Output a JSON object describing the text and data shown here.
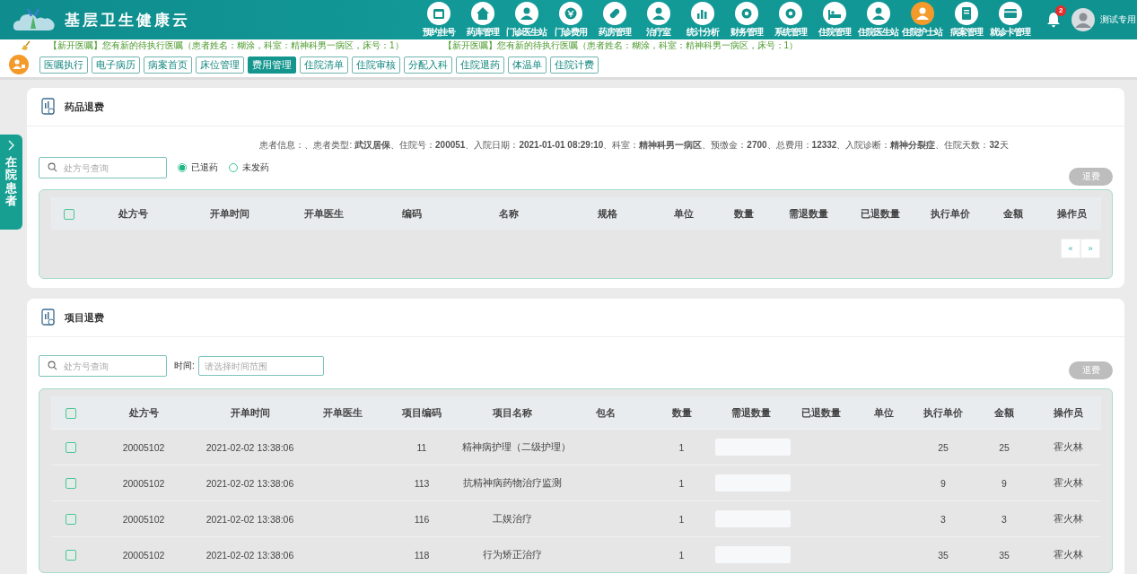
{
  "app": {
    "title": "基层卫生健康云"
  },
  "nav": [
    {
      "label": "预约挂号",
      "selected": false
    },
    {
      "label": "药库管理",
      "selected": false
    },
    {
      "label": "门诊医生站",
      "selected": false
    },
    {
      "label": "门诊费用",
      "selected": false
    },
    {
      "label": "药房管理",
      "selected": false
    },
    {
      "label": "治疗室",
      "selected": false
    },
    {
      "label": "统计分析",
      "selected": false
    },
    {
      "label": "财务管理",
      "selected": false
    },
    {
      "label": "系统管理",
      "selected": false
    },
    {
      "label": "住院管理",
      "selected": false
    },
    {
      "label": "住院医生站",
      "selected": false
    },
    {
      "label": "住院护士站",
      "selected": true
    },
    {
      "label": "病案管理",
      "selected": false
    },
    {
      "label": "就诊卡管理",
      "selected": false
    }
  ],
  "notifications": {
    "badge": "2"
  },
  "user": {
    "name": "测试专用"
  },
  "notices": [
    "【新开医嘱】您有新的待执行医嘱（患者姓名：糊涂，科室：精神科男一病区，床号：1）",
    "【新开医嘱】您有新的待执行医嘱（患者姓名：糊涂，科室：精神科男一病区，床号：1）"
  ],
  "tabs": [
    {
      "label": "医嘱执行",
      "selected": false
    },
    {
      "label": "电子病历",
      "selected": false
    },
    {
      "label": "病案首页",
      "selected": false
    },
    {
      "label": "床位管理",
      "selected": false
    },
    {
      "label": "费用管理",
      "selected": true
    },
    {
      "label": "住院清单",
      "selected": false
    },
    {
      "label": "住院审核",
      "selected": false
    },
    {
      "label": "分配入科",
      "selected": false
    },
    {
      "label": "住院退药",
      "selected": false
    },
    {
      "label": "体温单",
      "selected": false
    },
    {
      "label": "住院计费",
      "selected": false
    }
  ],
  "side_tab": {
    "label": "在院患者"
  },
  "drug_refund": {
    "title": "药品退费",
    "patient_info": "患者信息：、患者类型: **武汉居保**、住院号：**200051**、入院日期：**2021-01-01 08:29:10**、科室：**精神科男一病区**、预缴金：**2700**、总费用：**12332**、入院诊断：**精神分裂症**、住院天数：**32**天",
    "search": {
      "placeholder": "处方号查询"
    },
    "radios": [
      {
        "label": "已退药",
        "selected": true
      },
      {
        "label": "未发药",
        "selected": false
      }
    ],
    "refund_button": {
      "label": "退费",
      "disabled": true
    },
    "table": {
      "header_checkbox": {
        "checked": false
      },
      "columns": [
        "处方号",
        "开单时间",
        "开单医生",
        "编码",
        "名称",
        "规格",
        "单位",
        "数量",
        "需退数量",
        "已退数量",
        "执行单价",
        "金额",
        "操作员"
      ]
    },
    "pager": [
      "«",
      "»"
    ]
  },
  "item_refund": {
    "title": "项目退费",
    "search": {
      "placeholder": "处方号查询"
    },
    "time": {
      "label": "时间:",
      "placeholder": "请选择时间范围"
    },
    "refund_button": {
      "label": "退费",
      "disabled": true
    },
    "table": {
      "header_checkbox": {
        "checked": false
      },
      "columns": [
        "处方号",
        "开单时间",
        "开单医生",
        "项目编码",
        "项目名称",
        "包名",
        "数量",
        "需退数量",
        "已退数量",
        "单位",
        "执行单价",
        "金额",
        "操作员"
      ],
      "rows": [
        {
          "checked": false,
          "cells": [
            "20005102",
            "2021-02-02 13:38:06",
            "",
            "11",
            "精神病护理（二级护理）",
            "",
            "1",
            "",
            "",
            "",
            "25",
            "25",
            "霍火林"
          ]
        },
        {
          "checked": false,
          "cells": [
            "20005102",
            "2021-02-02 13:38:06",
            "",
            "113",
            "抗精神病药物治疗监测",
            "",
            "1",
            "",
            "",
            "",
            "9",
            "9",
            "霍火林"
          ]
        },
        {
          "checked": false,
          "cells": [
            "20005102",
            "2021-02-02 13:38:06",
            "",
            "116",
            "工娱治疗",
            "",
            "1",
            "",
            "",
            "",
            "3",
            "3",
            "霍火林"
          ]
        },
        {
          "checked": false,
          "cells": [
            "20005102",
            "2021-02-02 13:38:06",
            "",
            "118",
            "行为矫正治疗",
            "",
            "1",
            "",
            "",
            "",
            "35",
            "35",
            "霍火林"
          ]
        }
      ]
    }
  }
}
